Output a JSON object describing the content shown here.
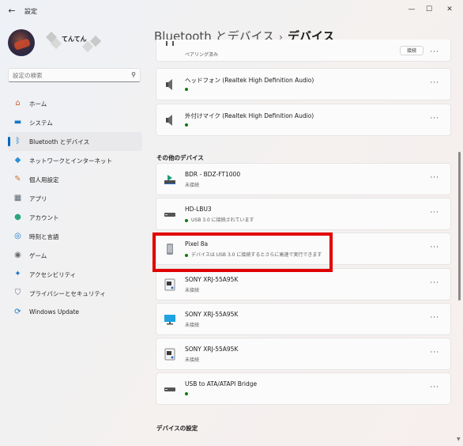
{
  "titlebar": {
    "app_title": "設定",
    "back_icon": "←",
    "minimize_icon": "—",
    "maximize_icon": "☐",
    "close_icon": "✕"
  },
  "user": {
    "name": "てんてん"
  },
  "search": {
    "placeholder": "設定の検索",
    "icon": "⚲"
  },
  "sidebar": {
    "items": [
      {
        "label": "ホーム",
        "icon": "home-icon",
        "glyph": "⌂",
        "color": "#c9642e",
        "active": false
      },
      {
        "label": "システム",
        "icon": "system-icon",
        "glyph": "▬",
        "color": "#1677c9",
        "active": false
      },
      {
        "label": "Bluetooth とデバイス",
        "icon": "bluetooth-icon",
        "glyph": "ᛒ",
        "color": "#1677c9",
        "active": true
      },
      {
        "label": "ネットワークとインターネット",
        "icon": "network-icon",
        "glyph": "◆",
        "color": "#2a8fd6",
        "active": false
      },
      {
        "label": "個人用設定",
        "icon": "personalization-icon",
        "glyph": "✎",
        "color": "#c97a2a",
        "active": false
      },
      {
        "label": "アプリ",
        "icon": "apps-icon",
        "glyph": "▦",
        "color": "#5b6572",
        "active": false
      },
      {
        "label": "アカウント",
        "icon": "account-icon",
        "glyph": "●",
        "color": "#2aa67a",
        "active": false
      },
      {
        "label": "時刻と言語",
        "icon": "time-language-icon",
        "glyph": "◎",
        "color": "#1677c9",
        "active": false
      },
      {
        "label": "ゲーム",
        "icon": "gaming-icon",
        "glyph": "◉",
        "color": "#6b6b6b",
        "active": false
      },
      {
        "label": "アクセシビリティ",
        "icon": "accessibility-icon",
        "glyph": "✦",
        "color": "#1677c9",
        "active": false
      },
      {
        "label": "プライバシーとセキュリティ",
        "icon": "privacy-shield-icon",
        "glyph": "⛉",
        "color": "#6b7480",
        "active": false
      },
      {
        "label": "Windows Update",
        "icon": "windows-update-icon",
        "glyph": "⟳",
        "color": "#1677c9",
        "active": false
      }
    ]
  },
  "breadcrumb": {
    "parent": "Bluetooth とデバイス",
    "separator": "›",
    "current": "デバイス"
  },
  "top_devices": [
    {
      "name": "",
      "status": "ペアリング済み",
      "icon": "device-icon",
      "button": "接続"
    },
    {
      "name": "ヘッドフォン (Realtek High Definition Audio)",
      "status": "",
      "icon": "speaker-icon",
      "dot": true
    },
    {
      "name": "外付けマイク (Realtek High Definition Audio)",
      "status": "",
      "icon": "speaker-icon",
      "dot": true
    }
  ],
  "other_devices": {
    "title": "その他のデバイス",
    "items": [
      {
        "name": "BDR - BDZ-FT1000",
        "status": "未接続",
        "icon": "bluray-recorder-icon",
        "dot": false
      },
      {
        "name": "HD-LBU3",
        "status": "USB 3.0 に接続されています",
        "icon": "drive-icon",
        "dot": true
      },
      {
        "name": "Pixel 8a",
        "status": "デバイスは USB 3.0 に接続するとさらに高速で実行できます",
        "icon": "phone-icon",
        "dot": true,
        "highlighted": true
      },
      {
        "name": "SONY XRJ-55A95K",
        "status": "未接続",
        "icon": "media-device-icon",
        "dot": false
      },
      {
        "name": "SONY XRJ-55A95K",
        "status": "未接続",
        "icon": "monitor-icon",
        "dot": false
      },
      {
        "name": "SONY XRJ-55A95K",
        "status": "未接続",
        "icon": "media-device-icon",
        "dot": false
      },
      {
        "name": "USB to ATA/ATAPI Bridge",
        "status": "",
        "icon": "drive-icon",
        "dot": true
      }
    ]
  },
  "device_settings": {
    "title": "デバイスの設定"
  },
  "more_label": "···",
  "colors": {
    "accent": "#0067c0",
    "status_ok": "#0f7b0f",
    "highlight": "#e10000"
  }
}
